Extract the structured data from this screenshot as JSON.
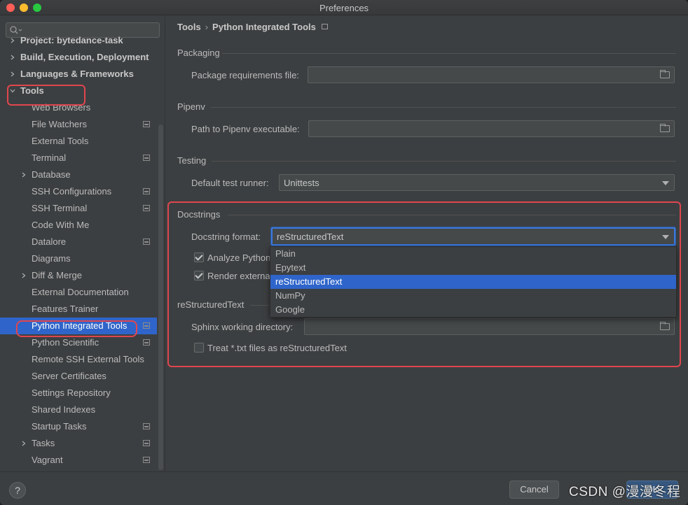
{
  "window": {
    "title": "Preferences"
  },
  "sidebar": {
    "search_placeholder": "",
    "items": [
      {
        "label": "Project: bytedance-task",
        "bold": true,
        "arrow": "right"
      },
      {
        "label": "Build, Execution, Deployment",
        "bold": true,
        "arrow": "right"
      },
      {
        "label": "Languages & Frameworks",
        "bold": true,
        "arrow": "right"
      },
      {
        "label": "Tools",
        "bold": true,
        "arrow": "down"
      },
      {
        "label": "Web Browsers"
      },
      {
        "label": "File Watchers",
        "page_icon": true
      },
      {
        "label": "External Tools"
      },
      {
        "label": "Terminal",
        "page_icon": true
      },
      {
        "label": "Database",
        "arrow": "right"
      },
      {
        "label": "SSH Configurations",
        "page_icon": true
      },
      {
        "label": "SSH Terminal",
        "page_icon": true
      },
      {
        "label": "Code With Me"
      },
      {
        "label": "Datalore",
        "page_icon": true
      },
      {
        "label": "Diagrams"
      },
      {
        "label": "Diff & Merge",
        "arrow": "right"
      },
      {
        "label": "External Documentation"
      },
      {
        "label": "Features Trainer"
      },
      {
        "label": "Python Integrated Tools",
        "page_icon": true,
        "selected": true
      },
      {
        "label": "Python Scientific",
        "page_icon": true
      },
      {
        "label": "Remote SSH External Tools"
      },
      {
        "label": "Server Certificates"
      },
      {
        "label": "Settings Repository"
      },
      {
        "label": "Shared Indexes"
      },
      {
        "label": "Startup Tasks",
        "page_icon": true
      },
      {
        "label": "Tasks",
        "arrow": "right",
        "page_icon": true
      },
      {
        "label": "Vagrant",
        "page_icon": true
      }
    ]
  },
  "breadcrumb": {
    "parent": "Tools",
    "separator": "›",
    "current": "Python Integrated Tools"
  },
  "packaging": {
    "section": "Packaging",
    "requirements_label": "Package requirements file:",
    "requirements_value": ""
  },
  "pipenv": {
    "section": "Pipenv",
    "path_label": "Path to Pipenv executable:",
    "path_value": ""
  },
  "testing": {
    "section": "Testing",
    "runner_label": "Default test runner:",
    "runner_value": "Unittests"
  },
  "docstrings": {
    "section": "Docstrings",
    "format_label": "Docstring format:",
    "format_value": "reStructuredText",
    "analyze_label": "Analyze Python",
    "analyze_checked": true,
    "render_label": "Render externa",
    "render_checked": true,
    "options": [
      "Plain",
      "Epytext",
      "reStructuredText",
      "NumPy",
      "Google"
    ],
    "selected_option": "reStructuredText"
  },
  "rest": {
    "section": "reStructuredText",
    "sphinx_label": "Sphinx working directory:",
    "sphinx_value": "",
    "treat_txt_label": "Treat *.txt files as reStructuredText",
    "treat_txt_checked": false
  },
  "footer": {
    "help_label": "?",
    "cancel_label": "Cancel",
    "ok_label": "OK"
  },
  "watermark": "CSDN @漫漫冬程",
  "colors": {
    "accent": "#2f65ca",
    "highlight_box": "#e0464e",
    "background": "#3c3f41"
  }
}
